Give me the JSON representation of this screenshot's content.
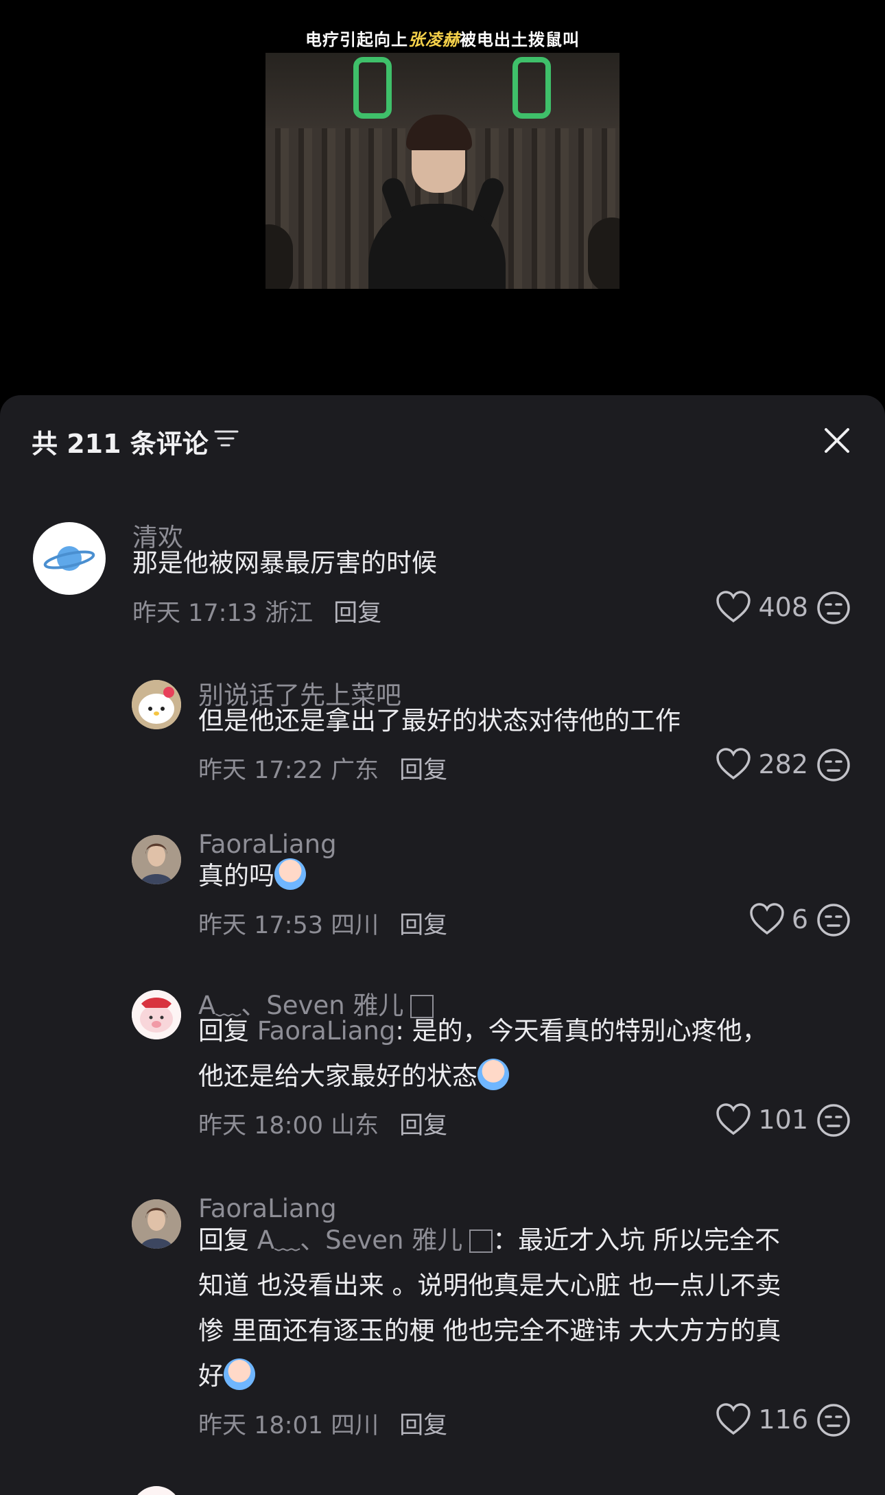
{
  "video": {
    "caption_prefix": "电疗引起向上",
    "caption_highlight": "张凌赫",
    "caption_suffix": "被电出土拨鼠叫"
  },
  "sheet": {
    "count_label": "共 211 条评论"
  },
  "comments": [
    {
      "name": "清欢",
      "text": "那是他被网暴最厉害的时候",
      "meta": "昨天 17:13 浙江",
      "reply": "回复",
      "likes": "408",
      "avatar_icon": "planet-icon"
    },
    {
      "name": "别说话了先上菜吧",
      "text": "但是他还是拿出了最好的状态对待他的工作",
      "meta": "昨天 17:22 广东",
      "reply": "回复",
      "likes": "282",
      "avatar_icon": "hello-kitty-avatar"
    },
    {
      "name": "FaoraLiang",
      "text": "真的吗",
      "meta": "昨天 17:53 四川",
      "reply": "回复",
      "likes": "6",
      "avatar_icon": "portrait-avatar"
    },
    {
      "name": "A﹏、Seven 雅儿",
      "reply_prefix": "回复 ",
      "reply_target": "FaoraLiang",
      "text_line1": ": 是的，今天看真的特别心疼他，",
      "text_line2": "他还是给大家最好的状态",
      "meta": "昨天 18:00 山东",
      "reply": "回复",
      "likes": "101",
      "avatar_icon": "pig-avatar"
    },
    {
      "name": "FaoraLiang",
      "reply_prefix": "回复 ",
      "reply_target": "A﹏、Seven 雅儿",
      "text_line1": "：最近才入坑 所以完全不",
      "text_line2": "知道 也没看出来 。说明他真是大心脏 也一点儿不卖",
      "text_line3": "惨 里面还有逐玉的梗 他也完全不避讳 大大方方的真",
      "text_line4": "好",
      "meta": "昨天 18:01 四川",
      "reply": "回复",
      "likes": "116",
      "avatar_icon": "portrait-avatar"
    }
  ],
  "colors": {
    "sheet_bg": "#1c1c20",
    "accent_caption": "#f6d24a",
    "handle_green": "#3fc06a"
  }
}
